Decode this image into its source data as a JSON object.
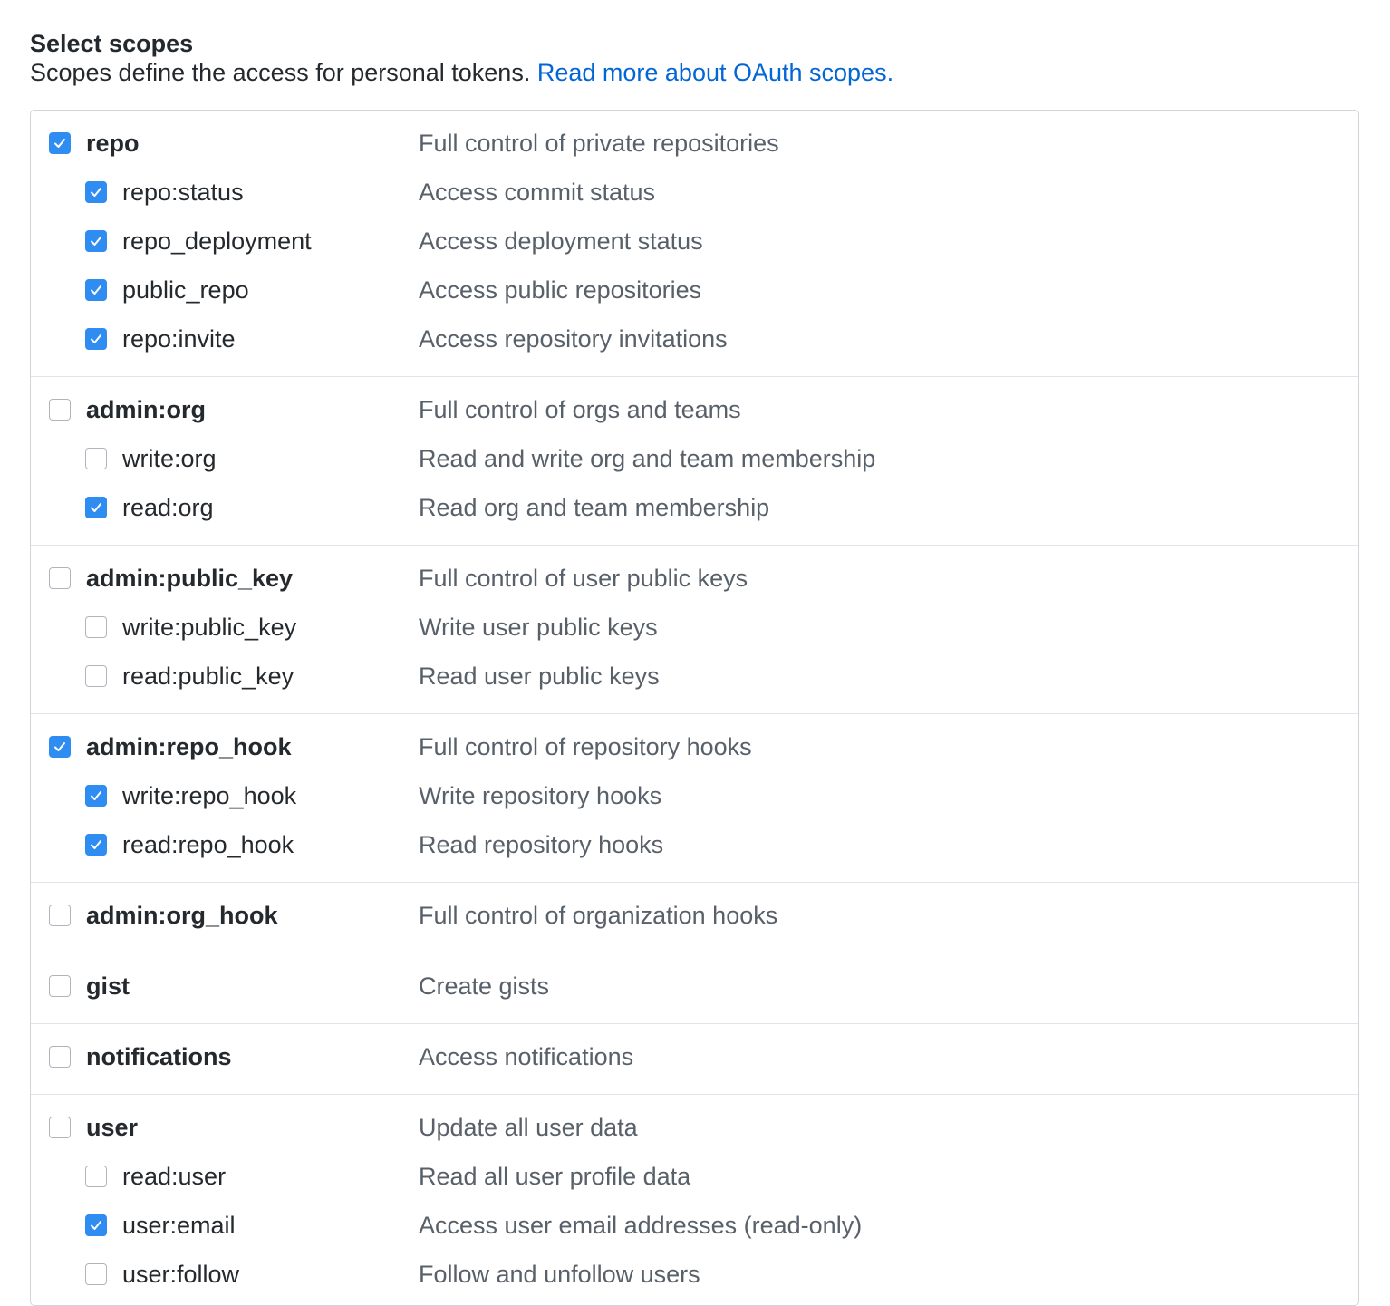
{
  "header": {
    "title": "Select scopes",
    "intro_text": "Scopes define the access for personal tokens.",
    "link_text": "Read more about OAuth scopes."
  },
  "colors": {
    "accent": "#2f8cf1",
    "link": "#0366d6",
    "text": "#24292e",
    "muted_text": "#586069",
    "border": "#d1d5da"
  },
  "groups": [
    {
      "scopes": [
        {
          "name": "repo",
          "description": "Full control of private repositories",
          "checked": true,
          "level": 0
        },
        {
          "name": "repo:status",
          "description": "Access commit status",
          "checked": true,
          "level": 1
        },
        {
          "name": "repo_deployment",
          "description": "Access deployment status",
          "checked": true,
          "level": 1
        },
        {
          "name": "public_repo",
          "description": "Access public repositories",
          "checked": true,
          "level": 1
        },
        {
          "name": "repo:invite",
          "description": "Access repository invitations",
          "checked": true,
          "level": 1
        }
      ]
    },
    {
      "scopes": [
        {
          "name": "admin:org",
          "description": "Full control of orgs and teams",
          "checked": false,
          "level": 0
        },
        {
          "name": "write:org",
          "description": "Read and write org and team membership",
          "checked": false,
          "level": 1
        },
        {
          "name": "read:org",
          "description": "Read org and team membership",
          "checked": true,
          "level": 1
        }
      ]
    },
    {
      "scopes": [
        {
          "name": "admin:public_key",
          "description": "Full control of user public keys",
          "checked": false,
          "level": 0
        },
        {
          "name": "write:public_key",
          "description": "Write user public keys",
          "checked": false,
          "level": 1
        },
        {
          "name": "read:public_key",
          "description": "Read user public keys",
          "checked": false,
          "level": 1
        }
      ]
    },
    {
      "scopes": [
        {
          "name": "admin:repo_hook",
          "description": "Full control of repository hooks",
          "checked": true,
          "level": 0
        },
        {
          "name": "write:repo_hook",
          "description": "Write repository hooks",
          "checked": true,
          "level": 1
        },
        {
          "name": "read:repo_hook",
          "description": "Read repository hooks",
          "checked": true,
          "level": 1
        }
      ]
    },
    {
      "scopes": [
        {
          "name": "admin:org_hook",
          "description": "Full control of organization hooks",
          "checked": false,
          "level": 0
        }
      ]
    },
    {
      "scopes": [
        {
          "name": "gist",
          "description": "Create gists",
          "checked": false,
          "level": 0
        }
      ]
    },
    {
      "scopes": [
        {
          "name": "notifications",
          "description": "Access notifications",
          "checked": false,
          "level": 0
        }
      ]
    },
    {
      "scopes": [
        {
          "name": "user",
          "description": "Update all user data",
          "checked": false,
          "level": 0
        },
        {
          "name": "read:user",
          "description": "Read all user profile data",
          "checked": false,
          "level": 1
        },
        {
          "name": "user:email",
          "description": "Access user email addresses (read-only)",
          "checked": true,
          "level": 1
        },
        {
          "name": "user:follow",
          "description": "Follow and unfollow users",
          "checked": false,
          "level": 1
        }
      ]
    }
  ]
}
